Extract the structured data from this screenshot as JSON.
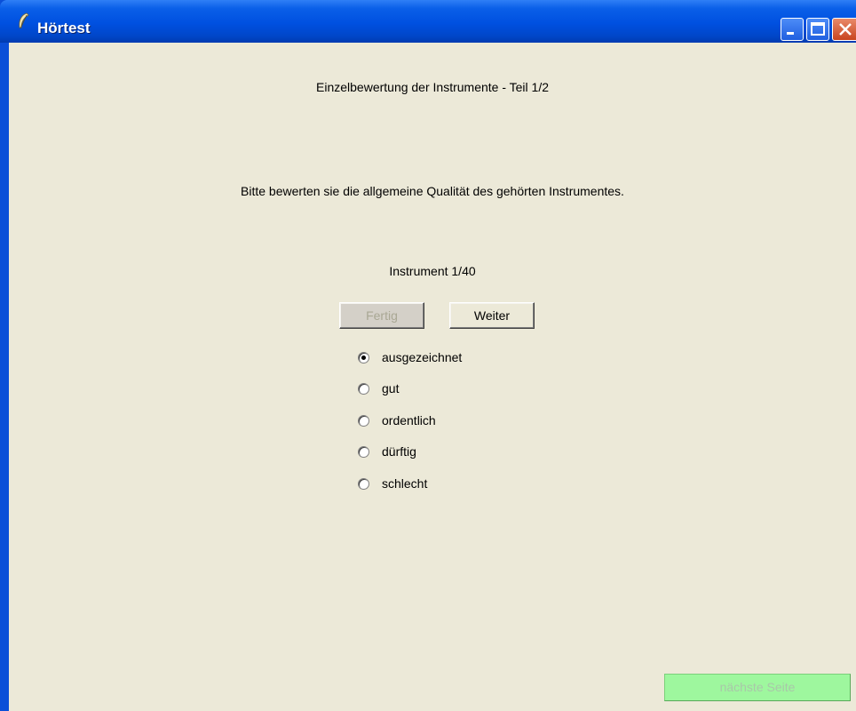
{
  "window": {
    "title": "Hörtest"
  },
  "main": {
    "section_title": "Einzelbewertung der Instrumente - Teil 1/2",
    "instruction": "Bitte bewerten sie die allgemeine Qualität des gehörten Instrumentes.",
    "counter": "Instrument 1/40",
    "buttons": {
      "done": "Fertig",
      "next": "Weiter"
    },
    "options": [
      {
        "label": "ausgezeichnet",
        "selected": true
      },
      {
        "label": "gut",
        "selected": false
      },
      {
        "label": "ordentlich",
        "selected": false
      },
      {
        "label": "dürftig",
        "selected": false
      },
      {
        "label": "schlecht",
        "selected": false
      }
    ]
  },
  "footer": {
    "next_page": "nächste Seite"
  }
}
